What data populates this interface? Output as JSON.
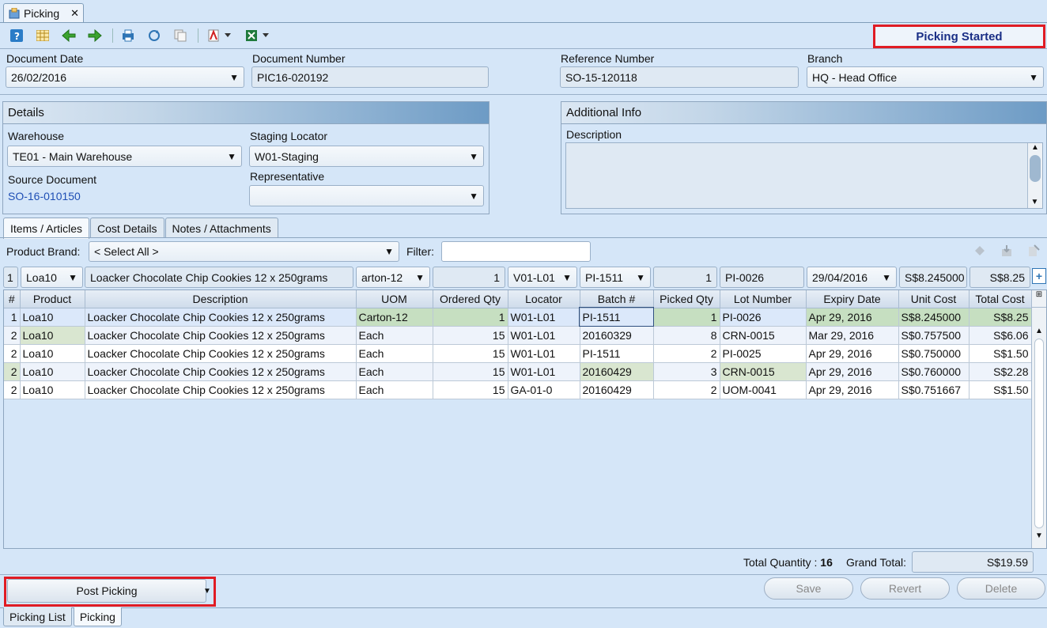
{
  "window": {
    "tab_title": "Picking",
    "tab_close": "✕"
  },
  "status": "Picking Started",
  "header": {
    "doc_date_label": "Document Date",
    "doc_date": "26/02/2016",
    "doc_number_label": "Document Number",
    "doc_number": "PIC16-020192",
    "ref_number_label": "Reference Number",
    "ref_number": "SO-15-120118",
    "branch_label": "Branch",
    "branch": "HQ - Head Office"
  },
  "details": {
    "title": "Details",
    "warehouse_label": "Warehouse",
    "warehouse": "TE01 - Main Warehouse",
    "staging_label": "Staging Locator",
    "staging": "W01-Staging",
    "source_label": "Source Document",
    "source": "SO-16-010150",
    "rep_label": "Representative",
    "rep": ""
  },
  "additional": {
    "title": "Additional Info",
    "desc_label": "Description",
    "desc": ""
  },
  "tabs": [
    "Items / Articles",
    "Cost Details",
    "Notes / Attachments"
  ],
  "filter": {
    "brand_label": "Product Brand:",
    "brand_value": "< Select All >",
    "filter_label": "Filter:",
    "filter_value": ""
  },
  "entry": {
    "idx": "1",
    "product": "Loa10",
    "description": "Loacker Chocolate Chip Cookies 12 x 250grams",
    "uom": "arton-12",
    "ordered": "1",
    "locator": "V01-L01",
    "batch": "PI-1511",
    "picked": "1",
    "lot": "PI-0026",
    "expiry": "29/04/2016",
    "unit_cost": "S$8.245000",
    "total_cost": "S$8.25",
    "add": "+"
  },
  "columns": [
    "#",
    "Product",
    "Description",
    "UOM",
    "Ordered Qty",
    "Locator",
    "Batch #",
    "Picked Qty",
    "Lot Number",
    "Expiry Date",
    "Unit Cost",
    "Total Cost"
  ],
  "rows": [
    [
      "1",
      "Loa10",
      "Loacker Chocolate Chip Cookies 12 x 250grams",
      "Carton-12",
      "1",
      "W01-L01",
      "PI-1511",
      "1",
      "PI-0026",
      "Apr 29, 2016",
      "S$8.245000",
      "S$8.25"
    ],
    [
      "2",
      "Loa10",
      "Loacker Chocolate Chip Cookies 12 x 250grams",
      "Each",
      "15",
      "W01-L01",
      "20160329",
      "8",
      "CRN-0015",
      "Mar 29, 2016",
      "S$0.757500",
      "S$6.06"
    ],
    [
      "2",
      "Loa10",
      "Loacker Chocolate Chip Cookies 12 x 250grams",
      "Each",
      "15",
      "W01-L01",
      "PI-1511",
      "2",
      "PI-0025",
      "Apr 29, 2016",
      "S$0.750000",
      "S$1.50"
    ],
    [
      "2",
      "Loa10",
      "Loacker Chocolate Chip Cookies 12 x 250grams",
      "Each",
      "15",
      "W01-L01",
      "20160429",
      "3",
      "CRN-0015",
      "Apr 29, 2016",
      "S$0.760000",
      "S$2.28"
    ],
    [
      "2",
      "Loa10",
      "Loacker Chocolate Chip Cookies 12 x 250grams",
      "Each",
      "15",
      "GA-01-0",
      "20160429",
      "2",
      "UOM-0041",
      "Apr 29, 2016",
      "S$0.751667",
      "S$1.50"
    ]
  ],
  "totals": {
    "qty_label": "Total Quantity :",
    "qty": "16",
    "grand_label": "Grand Total:",
    "grand": "S$19.59"
  },
  "actions": {
    "post": "Post Picking",
    "save": "Save",
    "revert": "Revert",
    "delete": "Delete"
  },
  "bottom_tabs": [
    "Picking List",
    "Picking"
  ],
  "colors": {
    "status_border": "#e01c24",
    "status_text": "#1a2f86",
    "link": "#1f4fb5"
  }
}
